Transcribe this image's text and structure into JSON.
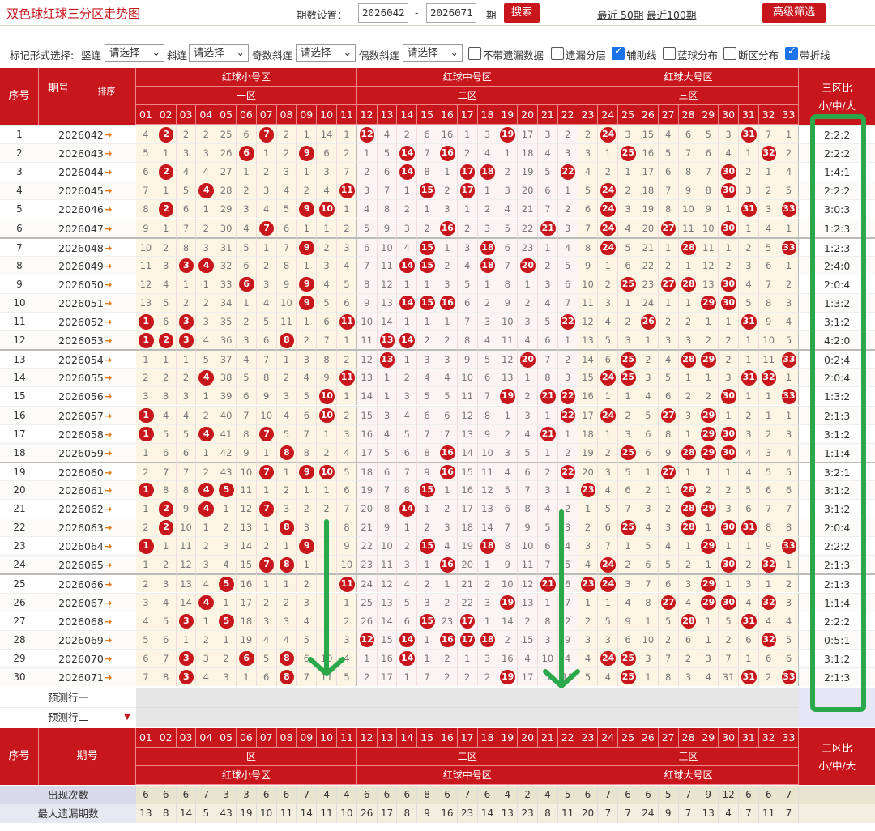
{
  "title": "双色球红球三分区走势图",
  "period_setting_label": "期数设置：",
  "period_from": "2026042",
  "period_to": "2026071",
  "period_sep": "-",
  "period_unit": "期",
  "search_btn": "搜索",
  "recent50": "最近 50期",
  "recent100": "最近100期",
  "advanced_btn": "高级筛选",
  "mark_label": "标记形式选择:",
  "selects": [
    {
      "label": "竖连",
      "value": "请选择"
    },
    {
      "label": "斜连",
      "value": "请选择"
    },
    {
      "label": "奇数斜连",
      "value": "请选择"
    },
    {
      "label": "偶数斜连",
      "value": "请选择"
    }
  ],
  "checkboxes": [
    {
      "label": "不带遗漏数据",
      "checked": false
    },
    {
      "label": "遗漏分层",
      "checked": false
    },
    {
      "label": "辅助线",
      "checked": true
    },
    {
      "label": "蓝球分布",
      "checked": false
    },
    {
      "label": "断区分布",
      "checked": false
    },
    {
      "label": "带折线",
      "checked": true
    }
  ],
  "header": {
    "serial": "序号",
    "period": "期号",
    "sort": "排序",
    "zone_groups": [
      "红球小号区",
      "红球中号区",
      "红球大号区"
    ],
    "zones": [
      "一区",
      "二区",
      "三区"
    ],
    "ratio_title": "三区比",
    "ratio_sub": "小/中/大"
  },
  "prediction_rows": [
    "预测行一",
    "预测行二"
  ],
  "stats": [
    {
      "label": "出现次数",
      "values": [
        6,
        6,
        6,
        7,
        3,
        3,
        6,
        6,
        7,
        4,
        4,
        6,
        6,
        6,
        8,
        6,
        7,
        6,
        4,
        2,
        4,
        5,
        6,
        7,
        6,
        6,
        5,
        7,
        9,
        12,
        6,
        6,
        7
      ]
    },
    {
      "label": "最大遗漏期数",
      "values": [
        13,
        8,
        14,
        5,
        43,
        19,
        10,
        11,
        14,
        11,
        10,
        26,
        17,
        8,
        9,
        16,
        23,
        14,
        13,
        23,
        8,
        11,
        20,
        7,
        7,
        24,
        9,
        7,
        13,
        4,
        7,
        11,
        7
      ]
    }
  ],
  "colors": {
    "accent": "#c8161d",
    "odd_row": "#fdf5e3",
    "even_row": "#fcefef",
    "annotation": "#2aa84a"
  },
  "chart_data": {
    "type": "table",
    "columns": [
      "01",
      "02",
      "03",
      "04",
      "05",
      "06",
      "07",
      "08",
      "09",
      "10",
      "11",
      "12",
      "13",
      "14",
      "15",
      "16",
      "17",
      "18",
      "19",
      "20",
      "21",
      "22",
      "23",
      "24",
      "25",
      "26",
      "27",
      "28",
      "29",
      "30",
      "31",
      "32",
      "33"
    ],
    "rows": [
      {
        "n": 1,
        "p": "2026042",
        "r": "2:2:2",
        "v": [
          4,
          "*",
          2,
          2,
          25,
          6,
          "*",
          2,
          1,
          14,
          1,
          "*",
          4,
          2,
          6,
          16,
          1,
          3,
          "*",
          17,
          3,
          2,
          2,
          "*",
          3,
          15,
          4,
          6,
          5,
          3,
          "*",
          7,
          1
        ]
      },
      {
        "n": 2,
        "p": "2026043",
        "r": "2:2:2",
        "v": [
          5,
          1,
          3,
          3,
          26,
          "*",
          1,
          2,
          "*",
          6,
          2,
          1,
          5,
          "*",
          7,
          "*",
          2,
          4,
          1,
          18,
          4,
          3,
          3,
          1,
          "*",
          16,
          5,
          7,
          6,
          4,
          1,
          "*",
          2
        ]
      },
      {
        "n": 3,
        "p": "2026044",
        "r": "1:4:1",
        "v": [
          6,
          "*",
          4,
          4,
          27,
          1,
          2,
          3,
          1,
          3,
          7,
          2,
          6,
          "*",
          8,
          1,
          "*",
          "*",
          2,
          19,
          5,
          "*",
          4,
          2,
          1,
          17,
          6,
          8,
          7,
          "*",
          2,
          1,
          4
        ]
      },
      {
        "n": 4,
        "p": "2026045",
        "r": "2:2:2",
        "v": [
          7,
          1,
          5,
          "*",
          28,
          2,
          3,
          4,
          2,
          4,
          "*",
          3,
          7,
          1,
          "*",
          2,
          "*",
          1,
          3,
          20,
          6,
          1,
          5,
          "*",
          2,
          18,
          7,
          9,
          8,
          "*",
          3,
          2,
          5
        ]
      },
      {
        "n": 5,
        "p": "2026046",
        "r": "3:0:3",
        "v": [
          8,
          "*",
          6,
          1,
          29,
          3,
          4,
          5,
          "*",
          "*",
          1,
          4,
          8,
          2,
          1,
          3,
          1,
          2,
          4,
          21,
          7,
          2,
          6,
          "*",
          3,
          19,
          8,
          10,
          9,
          1,
          "*",
          3,
          "*"
        ]
      },
      {
        "n": 6,
        "p": "2026047",
        "r": "1:2:3",
        "v": [
          9,
          1,
          7,
          2,
          30,
          4,
          "*",
          6,
          1,
          1,
          2,
          5,
          9,
          3,
          2,
          "*",
          2,
          3,
          5,
          22,
          "*",
          3,
          7,
          "*",
          4,
          20,
          "*",
          11,
          10,
          "*",
          1,
          4,
          1
        ]
      },
      {
        "n": 7,
        "p": "2026048",
        "r": "1:2:3",
        "v": [
          10,
          2,
          8,
          3,
          31,
          5,
          1,
          7,
          "*",
          2,
          3,
          6,
          10,
          4,
          "*",
          1,
          3,
          "*",
          6,
          23,
          1,
          4,
          8,
          "*",
          5,
          21,
          1,
          "*",
          11,
          1,
          2,
          5,
          "*"
        ]
      },
      {
        "n": 8,
        "p": "2026049",
        "r": "2:4:0",
        "v": [
          11,
          3,
          "*",
          "*",
          32,
          6,
          2,
          8,
          1,
          3,
          4,
          7,
          11,
          "*",
          "*",
          2,
          4,
          "*",
          7,
          "*",
          2,
          5,
          9,
          1,
          6,
          22,
          2,
          1,
          12,
          2,
          3,
          6,
          1
        ]
      },
      {
        "n": 9,
        "p": "2026050",
        "r": "2:0:4",
        "v": [
          12,
          4,
          1,
          1,
          33,
          "*",
          3,
          9,
          "*",
          4,
          5,
          8,
          12,
          1,
          1,
          3,
          5,
          1,
          8,
          1,
          3,
          6,
          10,
          2,
          "*",
          23,
          "*",
          "*",
          13,
          "*",
          4,
          7,
          2
        ]
      },
      {
        "n": 10,
        "p": "2026051",
        "r": "1:3:2",
        "v": [
          13,
          5,
          2,
          2,
          34,
          1,
          4,
          10,
          "*",
          5,
          6,
          9,
          13,
          "*",
          "*",
          "*",
          6,
          2,
          9,
          2,
          4,
          7,
          11,
          3,
          1,
          24,
          1,
          1,
          "*",
          "*",
          5,
          8,
          3
        ]
      },
      {
        "n": 11,
        "p": "2026052",
        "r": "3:1:2",
        "v": [
          "*",
          6,
          "*",
          3,
          35,
          2,
          5,
          11,
          1,
          6,
          "*",
          10,
          14,
          1,
          1,
          1,
          7,
          3,
          10,
          3,
          5,
          "*",
          12,
          4,
          2,
          "*",
          2,
          2,
          1,
          1,
          "*",
          9,
          4
        ]
      },
      {
        "n": 12,
        "p": "2026053",
        "r": "4:2:0",
        "v": [
          "*",
          "*",
          "*",
          4,
          36,
          3,
          6,
          "*",
          2,
          7,
          1,
          11,
          "*",
          "*",
          2,
          2,
          8,
          4,
          11,
          4,
          6,
          1,
          13,
          5,
          3,
          1,
          3,
          3,
          2,
          2,
          1,
          10,
          5
        ]
      },
      {
        "n": 13,
        "p": "2026054",
        "r": "0:2:4",
        "v": [
          1,
          1,
          1,
          5,
          37,
          4,
          7,
          1,
          3,
          8,
          2,
          12,
          "*",
          1,
          3,
          3,
          9,
          5,
          12,
          "*",
          7,
          2,
          14,
          6,
          "*",
          2,
          4,
          "*",
          "*",
          2,
          1,
          11,
          "*"
        ]
      },
      {
        "n": 14,
        "p": "2026055",
        "r": "2:0:4",
        "v": [
          2,
          2,
          2,
          "*",
          38,
          5,
          8,
          2,
          4,
          9,
          "*",
          13,
          1,
          2,
          4,
          4,
          10,
          6,
          13,
          1,
          8,
          3,
          15,
          "*",
          "*",
          3,
          5,
          1,
          1,
          3,
          "*",
          "*",
          1
        ]
      },
      {
        "n": 15,
        "p": "2026056",
        "r": "1:3:2",
        "v": [
          3,
          3,
          3,
          1,
          39,
          6,
          9,
          3,
          5,
          "*",
          1,
          14,
          1,
          3,
          5,
          5,
          11,
          7,
          "*",
          2,
          "*",
          "*",
          16,
          1,
          1,
          4,
          6,
          2,
          2,
          "*",
          1,
          1,
          "*"
        ]
      },
      {
        "n": 16,
        "p": "2026057",
        "r": "2:1:3",
        "v": [
          "*",
          4,
          4,
          2,
          40,
          7,
          10,
          4,
          6,
          "*",
          2,
          15,
          3,
          4,
          6,
          6,
          12,
          8,
          1,
          3,
          1,
          "*",
          17,
          "*",
          2,
          5,
          "*",
          3,
          "*",
          1,
          2,
          1,
          1
        ]
      },
      {
        "n": 17,
        "p": "2026058",
        "r": "3:1:2",
        "v": [
          "*",
          5,
          5,
          "*",
          41,
          8,
          "*",
          5,
          7,
          1,
          3,
          16,
          4,
          5,
          7,
          7,
          13,
          9,
          2,
          4,
          "*",
          1,
          18,
          1,
          3,
          6,
          8,
          1,
          "*",
          "*",
          3,
          2,
          3
        ]
      },
      {
        "n": 18,
        "p": "2026059",
        "r": "1:1:4",
        "v": [
          1,
          6,
          6,
          1,
          42,
          9,
          1,
          "*",
          8,
          2,
          4,
          17,
          5,
          6,
          8,
          "*",
          14,
          10,
          3,
          5,
          1,
          2,
          19,
          2,
          "*",
          6,
          9,
          "*",
          "*",
          "*",
          4,
          3,
          4
        ]
      },
      {
        "n": 19,
        "p": "2026060",
        "r": "3:2:1",
        "v": [
          2,
          7,
          7,
          2,
          43,
          10,
          "*",
          1,
          "*",
          "*",
          5,
          18,
          6,
          7,
          9,
          "*",
          15,
          11,
          4,
          6,
          2,
          "*",
          20,
          3,
          5,
          1,
          "*",
          1,
          1,
          1,
          4,
          5,
          5
        ]
      },
      {
        "n": 20,
        "p": "2026061",
        "r": "3:1:2",
        "v": [
          "*",
          8,
          8,
          "*",
          "*",
          11,
          1,
          2,
          1,
          1,
          6,
          19,
          7,
          8,
          "*",
          1,
          16,
          12,
          5,
          7,
          3,
          1,
          "*",
          4,
          6,
          2,
          1,
          "*",
          2,
          2,
          5,
          6,
          6
        ]
      },
      {
        "n": 21,
        "p": "2026062",
        "r": "3:1:2",
        "v": [
          1,
          "*",
          9,
          "*",
          1,
          12,
          "*",
          3,
          2,
          2,
          7,
          20,
          8,
          "*",
          1,
          2,
          17,
          13,
          6,
          8,
          4,
          2,
          1,
          5,
          7,
          3,
          2,
          "*",
          "*",
          3,
          6,
          7,
          7
        ]
      },
      {
        "n": 22,
        "p": "2026063",
        "r": "2:0:4",
        "v": [
          2,
          "*",
          10,
          1,
          2,
          13,
          1,
          "*",
          3,
          3,
          8,
          21,
          9,
          1,
          2,
          3,
          18,
          14,
          7,
          9,
          5,
          3,
          2,
          6,
          "*",
          4,
          3,
          "*",
          1,
          "*",
          "*",
          8,
          8
        ]
      },
      {
        "n": 23,
        "p": "2026064",
        "r": "2:2:2",
        "v": [
          "*",
          1,
          11,
          2,
          3,
          14,
          2,
          1,
          "*",
          4,
          9,
          22,
          10,
          2,
          "*",
          4,
          19,
          "*",
          8,
          10,
          6,
          4,
          3,
          7,
          1,
          5,
          4,
          1,
          "*",
          1,
          1,
          9,
          "*"
        ]
      },
      {
        "n": 24,
        "p": "2026065",
        "r": "2:1:3",
        "v": [
          1,
          2,
          12,
          3,
          4,
          15,
          "*",
          "*",
          1,
          5,
          10,
          23,
          11,
          3,
          1,
          "*",
          20,
          1,
          9,
          11,
          7,
          5,
          4,
          "*",
          2,
          6,
          5,
          2,
          1,
          "*",
          2,
          "*",
          1
        ]
      },
      {
        "n": 25,
        "p": "2026066",
        "r": "2:1:3",
        "v": [
          2,
          3,
          13,
          4,
          "*",
          16,
          1,
          1,
          2,
          6,
          "*",
          24,
          12,
          4,
          2,
          1,
          21,
          2,
          10,
          12,
          "*",
          6,
          "*",
          "*",
          3,
          7,
          6,
          3,
          "*",
          1,
          3,
          1,
          2
        ]
      },
      {
        "n": 26,
        "p": "2026067",
        "r": "1:1:4",
        "v": [
          3,
          4,
          14,
          "*",
          1,
          17,
          2,
          2,
          3,
          7,
          1,
          25,
          13,
          5,
          3,
          2,
          22,
          3,
          "*",
          13,
          1,
          7,
          1,
          1,
          4,
          8,
          "*",
          4,
          "*",
          "*",
          4,
          "*",
          3
        ]
      },
      {
        "n": 27,
        "p": "2026068",
        "r": "2:2:2",
        "v": [
          4,
          5,
          "*",
          1,
          "*",
          18,
          3,
          3,
          4,
          8,
          2,
          26,
          14,
          6,
          "*",
          23,
          "*",
          1,
          14,
          2,
          8,
          2,
          2,
          5,
          9,
          1,
          5,
          "*",
          1,
          5,
          "*",
          4,
          4
        ]
      },
      {
        "n": 28,
        "p": "2026069",
        "r": "0:5:1",
        "v": [
          5,
          6,
          1,
          2,
          1,
          19,
          4,
          4,
          5,
          9,
          3,
          "*",
          15,
          "*",
          1,
          "*",
          "*",
          "*",
          2,
          15,
          3,
          9,
          3,
          3,
          6,
          10,
          2,
          6,
          1,
          2,
          6,
          "*",
          5
        ]
      },
      {
        "n": 29,
        "p": "2026070",
        "r": "3:1:2",
        "v": [
          6,
          7,
          "*",
          3,
          2,
          "*",
          5,
          "*",
          6,
          10,
          4,
          1,
          16,
          "*",
          1,
          2,
          1,
          3,
          16,
          4,
          10,
          4,
          4,
          "*",
          "*",
          3,
          7,
          2,
          3,
          7,
          1,
          6,
          6
        ]
      },
      {
        "n": 30,
        "p": "2026071",
        "r": "2:1:3",
        "v": [
          7,
          8,
          "*",
          4,
          3,
          1,
          6,
          "*",
          7,
          11,
          5,
          2,
          17,
          1,
          7,
          2,
          2,
          2,
          "*",
          17,
          5,
          11,
          5,
          4,
          "*",
          1,
          8,
          3,
          4,
          31,
          "*",
          2,
          "*"
        ]
      }
    ]
  }
}
